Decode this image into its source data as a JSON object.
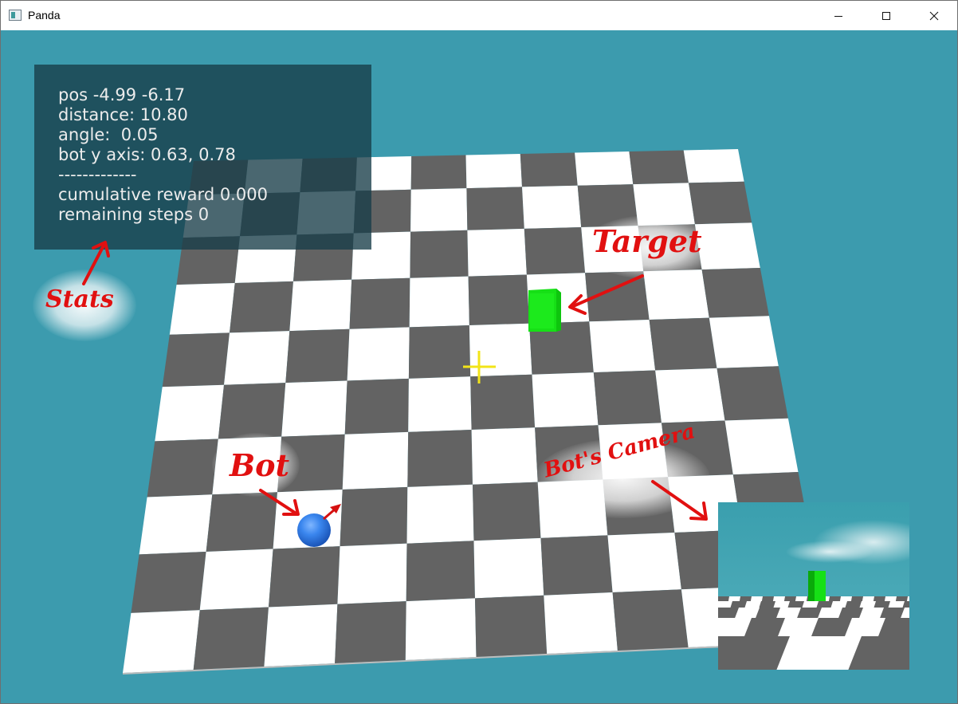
{
  "window": {
    "title": "Panda",
    "controls": [
      "minimize-icon",
      "maximize-icon",
      "close-icon"
    ]
  },
  "stats": {
    "pos": "pos -4.99 -6.17",
    "distance": "distance: 10.80",
    "angle": "angle:  0.05",
    "bot_y_axis": "bot y axis: 0.63, 0.78",
    "separator": "-------------",
    "cumulative_reward": "cumulative reward 0.000",
    "remaining_steps": "remaining steps 0"
  },
  "annotations": {
    "stats": "Stats",
    "target": "Target",
    "bot": "Bot",
    "bot_camera": "Bot's Camera"
  },
  "colors": {
    "background": "#3c9bae",
    "board_dark": "#636363",
    "board_light": "#ffffff",
    "target": "#18e018",
    "bot": "#2f7ce8",
    "crosshair": "#f2e418",
    "annotation": "#e11010"
  }
}
